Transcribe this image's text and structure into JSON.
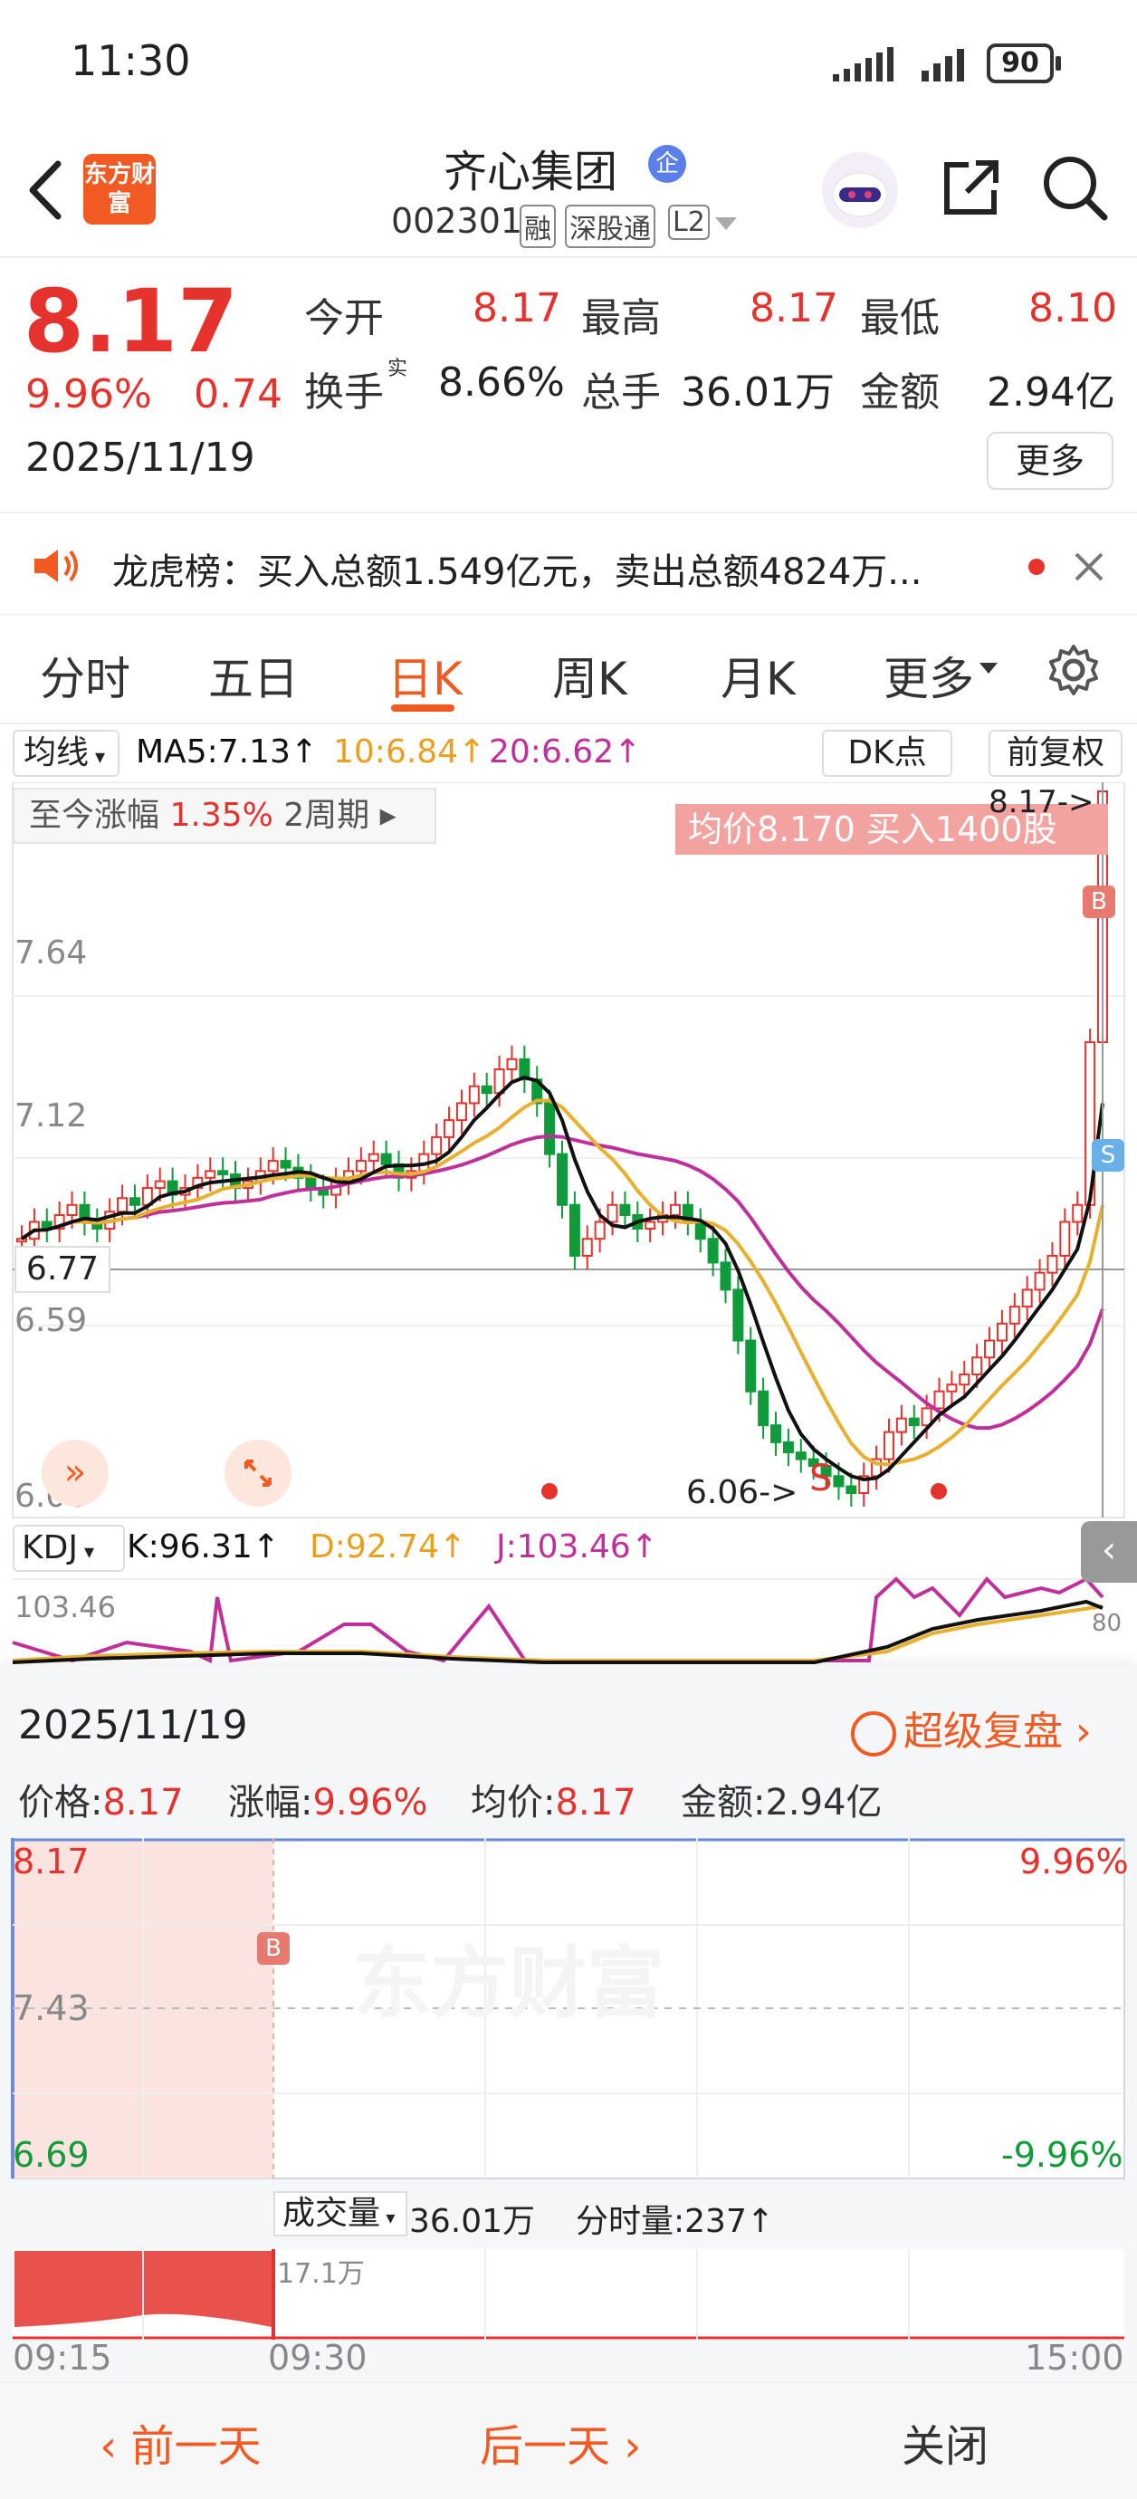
{
  "status": {
    "time": "11:30",
    "battery": "90"
  },
  "header": {
    "name": "齐心集团",
    "code": "002301",
    "tags": [
      "融",
      "深股通",
      "L2"
    ],
    "app_logo": "东方财富",
    "badge": "企"
  },
  "quote": {
    "price": "8.17",
    "pct": "9.96%",
    "chg": "0.74",
    "date": "2025/11/19",
    "open_label": "今开",
    "open": "8.17",
    "high_label": "最高",
    "high": "8.17",
    "low_label": "最低",
    "low": "8.10",
    "turnover_label": "换手",
    "turnover_sup": "实",
    "turnover": "8.66%",
    "volume_label": "总手",
    "volume": "36.01万",
    "amount_label": "金额",
    "amount": "2.94亿",
    "more": "更多"
  },
  "notice": {
    "text": "龙虎榜：买入总额1.549亿元，卖出总额4824万..."
  },
  "tabs": [
    "分时",
    "五日",
    "日K",
    "周K",
    "月K",
    "更多"
  ],
  "active_tab": "日K",
  "kchart": {
    "ma_selector": "均线",
    "ma5": "MA5:7.13↑",
    "ma10": "10:6.84↑",
    "ma20": "20:6.62↑",
    "dk": "DK点",
    "fq": "前复权",
    "since_label": "至今涨幅",
    "since_val": "1.35%",
    "since_period": "2周期",
    "banner": "均价8.170  买入1400股",
    "price_tag": "8.17->",
    "low_tag": "6.06->",
    "cur_price": "6.77",
    "axis": [
      "7.64",
      "7.12",
      "6.59",
      "6.06"
    ]
  },
  "kdj": {
    "selector": "KDJ",
    "k": "K:96.31↑",
    "d": "D:92.74↑",
    "j": "J:103.46↑",
    "top": "103.46",
    "right": "80"
  },
  "replay": {
    "date": "2025/11/19",
    "link": "超级复盘",
    "price_label": "价格:",
    "price": "8.17",
    "pct_label": "涨幅:",
    "pct": "9.96%",
    "avg_label": "均价:",
    "avg": "8.17",
    "amt_label": "金额:",
    "amt": "2.94亿",
    "axis_left": [
      "8.17",
      "7.43",
      "6.69"
    ],
    "axis_right": [
      "9.96%",
      "-9.96%"
    ],
    "vol_label": "成交量",
    "vol": "36.01万",
    "tick_label": "分时量:237↑",
    "vol_peak": "17.1万",
    "times": [
      "09:15",
      "09:30",
      "15:00"
    ],
    "watermark": "东方财富"
  },
  "bottom": {
    "prev": "前一天",
    "next": "后一天",
    "close": "关闭"
  },
  "chart_data": {
    "type": "candlestick",
    "ylim": [
      6.06,
      8.17
    ],
    "ma_colors": {
      "ma5": "#111111",
      "ma10": "#e8b030",
      "ma20": "#c0309a"
    },
    "closes": [
      6.85,
      6.9,
      6.88,
      6.92,
      6.95,
      6.9,
      6.88,
      6.93,
      6.97,
      6.95,
      7.0,
      7.02,
      6.98,
      7.0,
      7.03,
      7.05,
      7.04,
      7.0,
      7.02,
      7.05,
      7.08,
      7.06,
      7.03,
      7.0,
      6.98,
      7.02,
      7.05,
      7.08,
      7.1,
      7.07,
      7.03,
      7.05,
      7.1,
      7.15,
      7.2,
      7.25,
      7.3,
      7.28,
      7.35,
      7.38,
      7.32,
      7.25,
      7.1,
      6.95,
      6.8,
      6.85,
      6.9,
      6.95,
      6.92,
      6.88,
      6.9,
      6.92,
      6.95,
      6.9,
      6.85,
      6.78,
      6.7,
      6.55,
      6.4,
      6.3,
      6.25,
      6.22,
      6.2,
      6.18,
      6.15,
      6.12,
      6.1,
      6.15,
      6.2,
      6.28,
      6.32,
      6.3,
      6.35,
      6.4,
      6.42,
      6.45,
      6.5,
      6.55,
      6.6,
      6.65,
      6.7,
      6.75,
      6.8,
      6.9,
      6.95,
      7.43,
      8.17
    ]
  },
  "colors": {
    "up": "#e5322d",
    "down": "#0f9b3a",
    "accent": "#ff6a1a"
  }
}
